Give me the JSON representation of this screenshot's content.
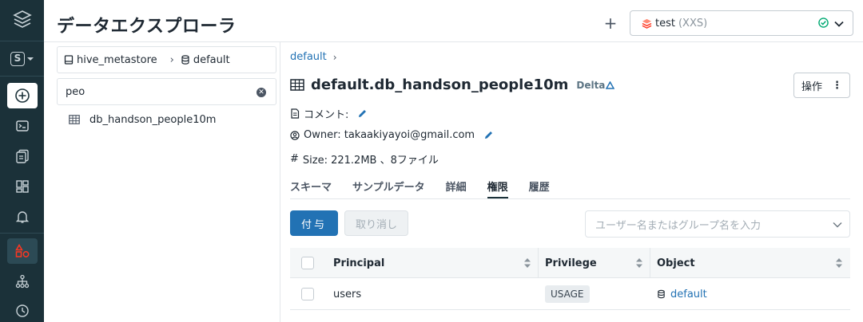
{
  "page": {
    "title": "データエクスプローラ"
  },
  "rail": {
    "items": [
      "logo",
      "workspace-switcher",
      "create",
      "sql-editor",
      "queries",
      "dashboards",
      "alerts",
      "data",
      "workflows",
      "history"
    ],
    "workspace_letter": "S"
  },
  "header": {
    "add_label": "+",
    "warehouse": {
      "name": "test",
      "size": "(XXS)",
      "status": "running"
    }
  },
  "left_panel": {
    "breadcrumb": {
      "catalog": "hive_metastore",
      "schema": "default"
    },
    "search": {
      "value": "peo"
    },
    "results": [
      {
        "label": "db_handson_people10m",
        "icon": "table-icon"
      }
    ]
  },
  "details": {
    "breadcrumb": {
      "schema": "default"
    },
    "table_name": "default.db_handson_people10m",
    "format_badge": "Delta",
    "ops_label": "操作",
    "comment_label": "コメント:",
    "owner_text": "Owner: takaakiyayoi@gmail.com",
    "size_text": "Size: 221.2MB 、8ファイル",
    "tabs": [
      {
        "label": "スキーマ",
        "active": false
      },
      {
        "label": "サンプルデータ",
        "active": false
      },
      {
        "label": "詳細",
        "active": false
      },
      {
        "label": "権限",
        "active": true
      },
      {
        "label": "履歴",
        "active": false
      }
    ],
    "grant_label": "付与",
    "revoke_label": "取り消し",
    "user_filter_placeholder": "ユーザー名またはグループ名を入力",
    "table": {
      "columns": [
        "Principal",
        "Privilege",
        "Object"
      ],
      "rows": [
        {
          "principal": "users",
          "privilege": "USAGE",
          "object": "default"
        }
      ]
    }
  },
  "colors": {
    "rail_bg": "#1b3139",
    "accent_blue": "#2272b4",
    "alert_red": "#ff3621",
    "success_green": "#00a972"
  }
}
